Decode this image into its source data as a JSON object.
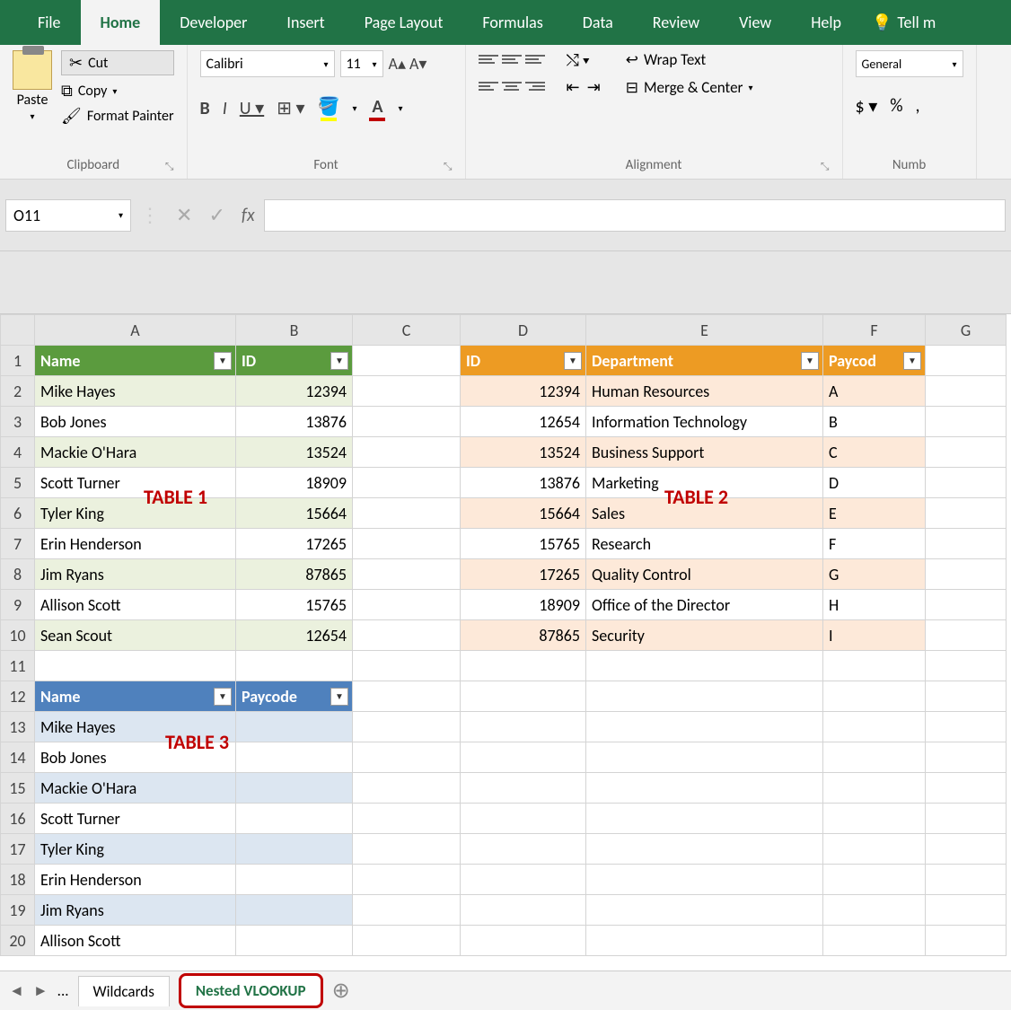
{
  "tabs": {
    "file": "File",
    "home": "Home",
    "developer": "Developer",
    "insert": "Insert",
    "page_layout": "Page Layout",
    "formulas": "Formulas",
    "data": "Data",
    "review": "Review",
    "view": "View",
    "help": "Help",
    "tell": "Tell m"
  },
  "ribbon": {
    "clipboard": {
      "paste": "Paste",
      "cut": "Cut",
      "copy": "Copy",
      "painter": "Format Painter",
      "label": "Clipboard"
    },
    "font": {
      "name": "Calibri",
      "size": "11",
      "label": "Font"
    },
    "alignment": {
      "wrap": "Wrap Text",
      "merge": "Merge & Center",
      "label": "Alignment"
    },
    "number": {
      "format": "General",
      "label": "Numb"
    }
  },
  "namebox": "O11",
  "formula": "",
  "columns": [
    "A",
    "B",
    "C",
    "D",
    "E",
    "F",
    "G"
  ],
  "annotations": {
    "t1": "TABLE 1",
    "t2": "TABLE 2",
    "t3": "TABLE 3"
  },
  "table1": {
    "headers": [
      "Name",
      "ID"
    ],
    "rows": [
      [
        "Mike Hayes",
        "12394"
      ],
      [
        "Bob Jones",
        "13876"
      ],
      [
        "Mackie O'Hara",
        "13524"
      ],
      [
        "Scott Turner",
        "18909"
      ],
      [
        "Tyler King",
        "15664"
      ],
      [
        "Erin Henderson",
        "17265"
      ],
      [
        "Jim Ryans",
        "87865"
      ],
      [
        "Allison Scott",
        "15765"
      ],
      [
        "Sean Scout",
        "12654"
      ]
    ]
  },
  "table2": {
    "headers": [
      "ID",
      "Department",
      "Paycode"
    ],
    "rows": [
      [
        "12394",
        "Human Resources",
        "A"
      ],
      [
        "12654",
        "Information Technology",
        "B"
      ],
      [
        "13524",
        "Business Support",
        "C"
      ],
      [
        "13876",
        "Marketing",
        "D"
      ],
      [
        "15664",
        "Sales",
        "E"
      ],
      [
        "15765",
        "Research",
        "F"
      ],
      [
        "17265",
        "Quality Control",
        "G"
      ],
      [
        "18909",
        "Office of the Director",
        "H"
      ],
      [
        "87865",
        "Security",
        "I"
      ]
    ]
  },
  "table3": {
    "headers": [
      "Name",
      "Paycode"
    ],
    "rows": [
      [
        "Mike Hayes",
        ""
      ],
      [
        "Bob Jones",
        ""
      ],
      [
        "Mackie O'Hara",
        ""
      ],
      [
        "Scott Turner",
        ""
      ],
      [
        "Tyler King",
        ""
      ],
      [
        "Erin Henderson",
        ""
      ],
      [
        "Jim Ryans",
        ""
      ],
      [
        "Allison Scott",
        ""
      ]
    ]
  },
  "sheets": {
    "ellipsis": "...",
    "wildcards": "Wildcards",
    "nested": "Nested VLOOKUP"
  }
}
